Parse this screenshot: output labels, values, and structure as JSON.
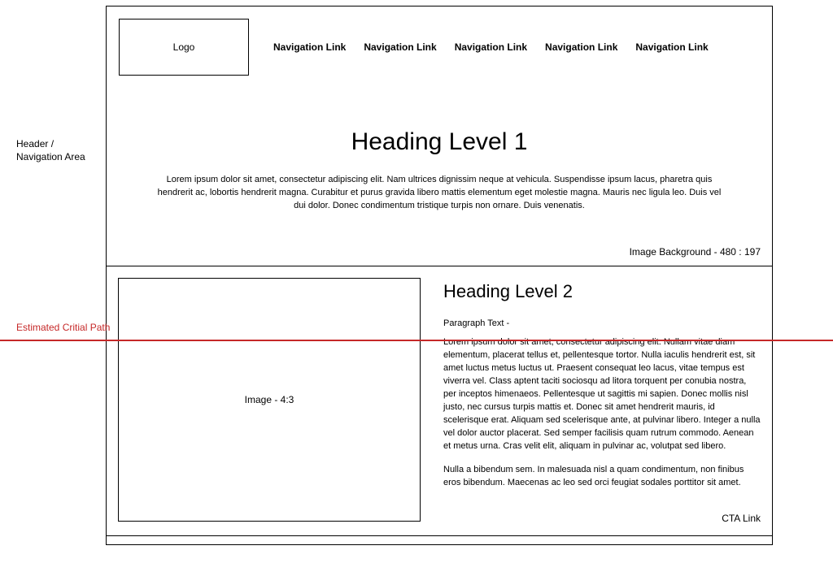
{
  "annotations": {
    "header_area": "Header /\nNavigation Area",
    "critical_path": "Estimated Critial Path"
  },
  "header": {
    "logo_label": "Logo",
    "nav": [
      "Navigation Link",
      "Navigation Link",
      "Navigation Link",
      "Navigation Link",
      "Navigation Link"
    ],
    "heading1": "Heading Level 1",
    "intro": "Lorem ipsum dolor sit amet, consectetur adipiscing elit. Nam ultrices dignissim neque at vehicula. Suspendisse ipsum lacus, pharetra quis hendrerit ac, lobortis hendrerit magna. Curabitur et purus gravida libero mattis elementum eget molestie magna. Mauris nec ligula leo. Duis vel dui dolor. Donec condimentum tristique turpis non ornare. Duis venenatis.",
    "bg_label": "Image Background - 480 : 197"
  },
  "content": {
    "image_label": "Image - 4:3",
    "heading2": "Heading Level 2",
    "para_tag": "Paragraph Text -",
    "body1": "Lorem ipsum dolor sit amet, consectetur adipiscing elit. Nullam vitae diam elementum, placerat tellus et, pellentesque tortor. Nulla iaculis hendrerit est, sit amet luctus metus luctus ut. Praesent consequat leo lacus, vitae tempus est viverra vel. Class aptent taciti sociosqu ad litora torquent per conubia nostra, per inceptos himenaeos. Pellentesque ut sagittis mi sapien. Donec mollis nisl justo, nec cursus turpis mattis et. Donec sit amet hendrerit mauris, id scelerisque erat. Aliquam sed scelerisque ante, at pulvinar libero. Integer a nulla vel dolor auctor placerat. Sed semper facilisis quam rutrum commodo. Aenean et metus urna. Cras velit elit, aliquam in pulvinar ac, volutpat sed libero.",
    "body2": "Nulla a bibendum sem. In malesuada nisl a quam condimentum, non finibus eros bibendum. Maecenas ac leo sed orci feugiat sodales porttitor sit amet.",
    "cta": "CTA Link"
  }
}
